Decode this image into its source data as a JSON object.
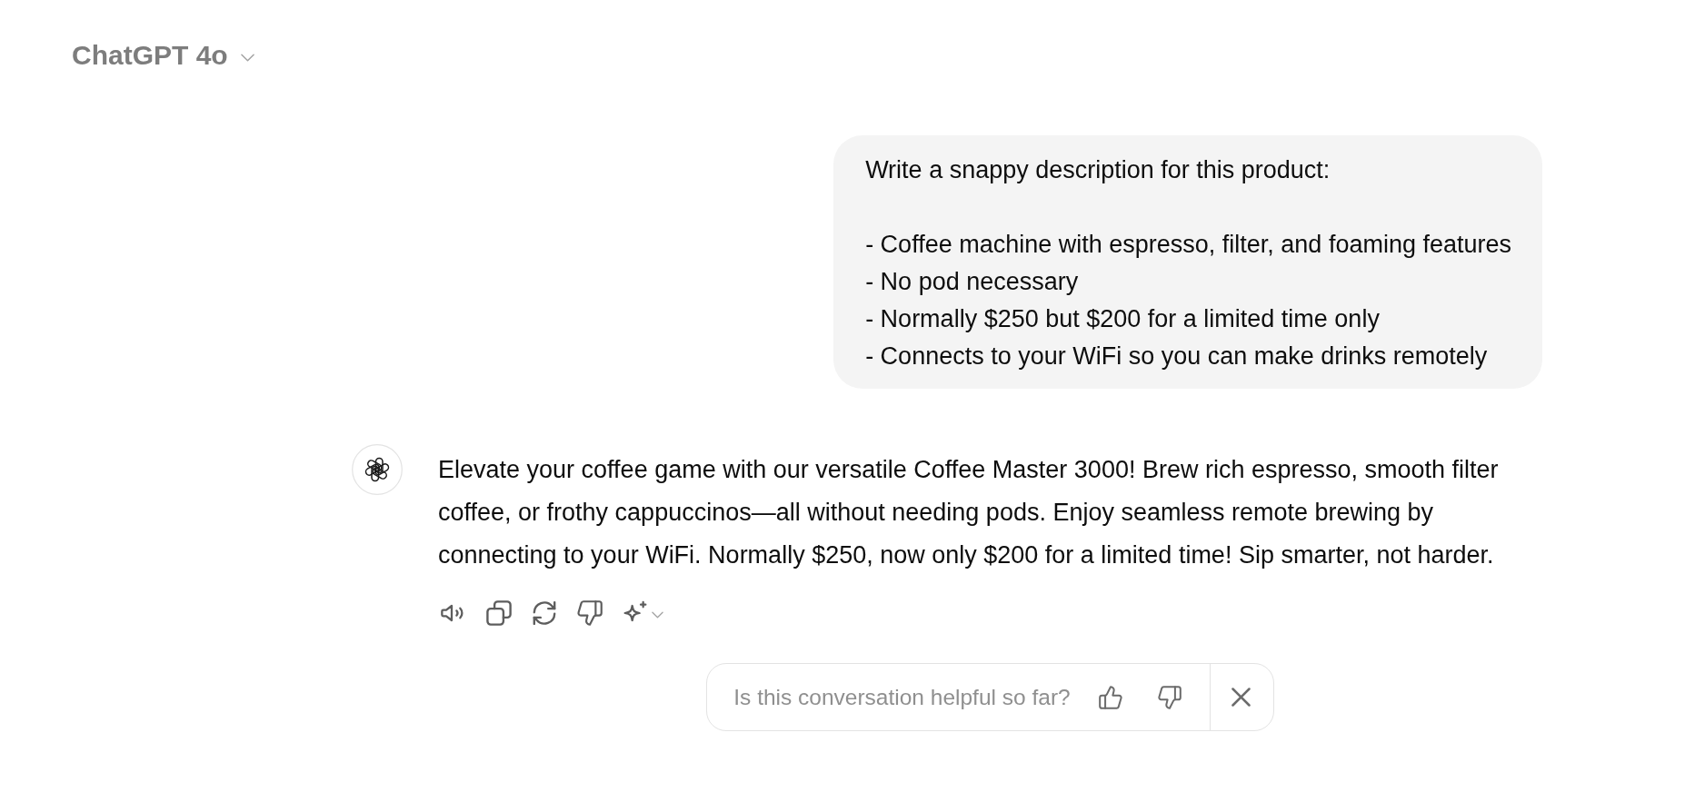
{
  "header": {
    "model_name": "ChatGPT 4o"
  },
  "user_message": {
    "intro": "Write a snappy description for this product:",
    "items": [
      "- Coffee machine with espresso, filter, and foaming features",
      "- No pod necessary",
      "- Normally $250 but $200 for a limited time only",
      "- Connects to your WiFi so you can make drinks remotely"
    ]
  },
  "assistant_message": {
    "lines": [
      "Elevate your coffee game with our versatile Coffee Master 3000! Brew rich espresso, smooth filter",
      "coffee, or frothy cappuccinos—all without needing pods. Enjoy seamless remote brewing by",
      "connecting to your WiFi. Normally $250, now only $200 for a limited time! Sip smarter, not harder."
    ]
  },
  "feedback_prompt": {
    "question": "Is this conversation helpful so far?"
  }
}
